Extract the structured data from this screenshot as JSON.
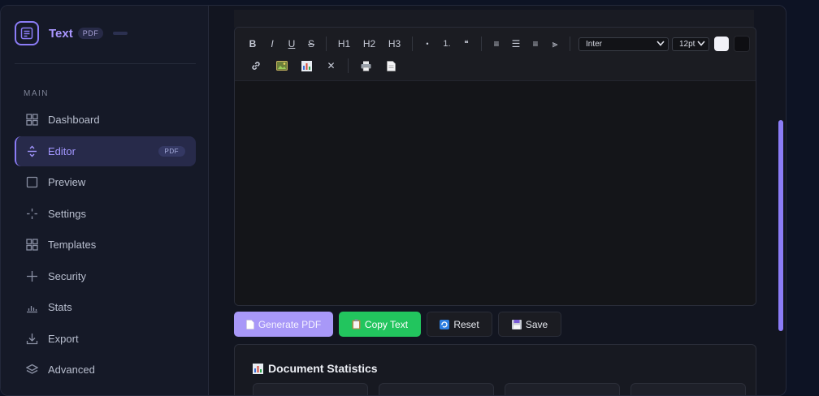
{
  "app": {
    "name": "Text",
    "badge": "PDF"
  },
  "sidebar": {
    "section_label": "MAIN",
    "items": [
      {
        "label": "Dashboard",
        "icon": "grid-icon"
      },
      {
        "label": "Editor",
        "icon": "editor-arrows-icon",
        "badge": "PDF",
        "active": true
      },
      {
        "label": "Preview",
        "icon": "square-icon"
      },
      {
        "label": "Settings",
        "icon": "sparkle-icon"
      },
      {
        "label": "Templates",
        "icon": "grid-icon"
      },
      {
        "label": "Security",
        "icon": "plus-icon"
      },
      {
        "label": "Stats",
        "icon": "bar-chart-icon"
      },
      {
        "label": "Export",
        "icon": "download-icon"
      },
      {
        "label": "Advanced",
        "icon": "layers-icon"
      }
    ]
  },
  "toolbar": {
    "bold": "B",
    "italic": "I",
    "underline": "U",
    "strike": "S",
    "h1": "H1",
    "h2": "H2",
    "h3": "H3",
    "bullet": "•",
    "numbered": "1.",
    "quote": "❝",
    "align_left": "≡",
    "align_center": "☰",
    "align_right": "≡",
    "justify": "⫸",
    "clear": "✕",
    "font_value": "Inter",
    "size_value": "12pt",
    "text_color": "#f1f1f8",
    "bg_color": "#0e0e12"
  },
  "actions": {
    "generate_pdf": "Generate PDF",
    "copy_text": "Copy Text",
    "reset": "Reset",
    "save": "Save"
  },
  "stats": {
    "title": "Document Statistics"
  },
  "colors": {
    "accent": "#8b7cf6",
    "success": "#22c55e",
    "primary_button": "#a898f8"
  }
}
